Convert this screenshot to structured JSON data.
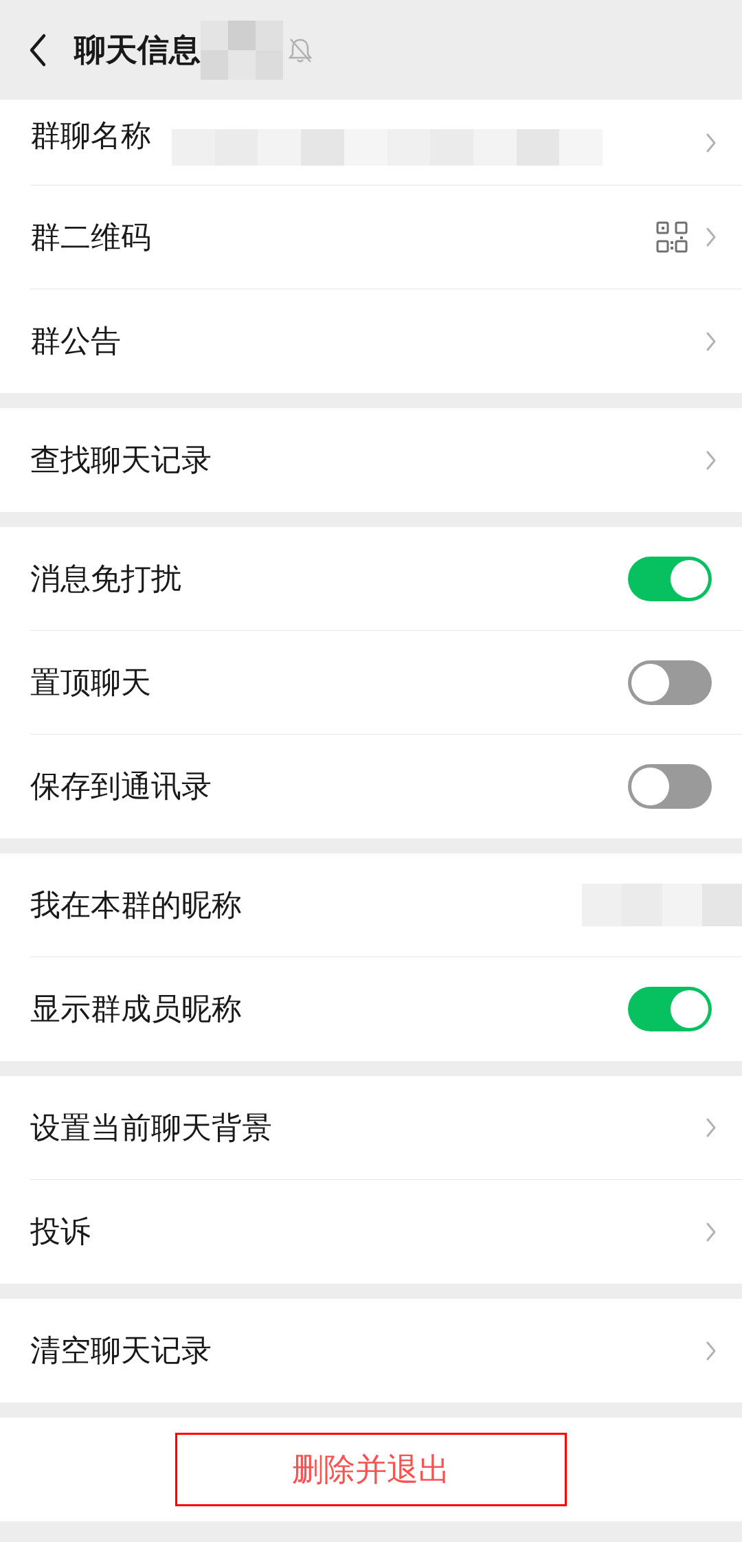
{
  "header": {
    "title": "聊天信息",
    "name_redacted": true,
    "muted": true
  },
  "sections": [
    {
      "items": [
        {
          "kind": "link",
          "label": "群聊名称",
          "value_redacted": true,
          "cut_top": true
        },
        {
          "kind": "link",
          "label": "群二维码",
          "qr": true
        },
        {
          "kind": "link",
          "label": "群公告"
        }
      ]
    },
    {
      "items": [
        {
          "kind": "link",
          "label": "查找聊天记录"
        }
      ]
    },
    {
      "items": [
        {
          "kind": "toggle",
          "label": "消息免打扰",
          "on": true
        },
        {
          "kind": "toggle",
          "label": "置顶聊天",
          "on": false
        },
        {
          "kind": "toggle",
          "label": "保存到通讯录",
          "on": false
        }
      ]
    },
    {
      "items": [
        {
          "kind": "value",
          "label": "我在本群的昵称",
          "value_redacted": true
        },
        {
          "kind": "toggle",
          "label": "显示群成员昵称",
          "on": true
        }
      ]
    },
    {
      "items": [
        {
          "kind": "link",
          "label": "设置当前聊天背景"
        },
        {
          "kind": "link",
          "label": "投诉"
        }
      ]
    },
    {
      "items": [
        {
          "kind": "link",
          "label": "清空聊天记录"
        }
      ]
    }
  ],
  "danger_button": {
    "label": "删除并退出"
  }
}
